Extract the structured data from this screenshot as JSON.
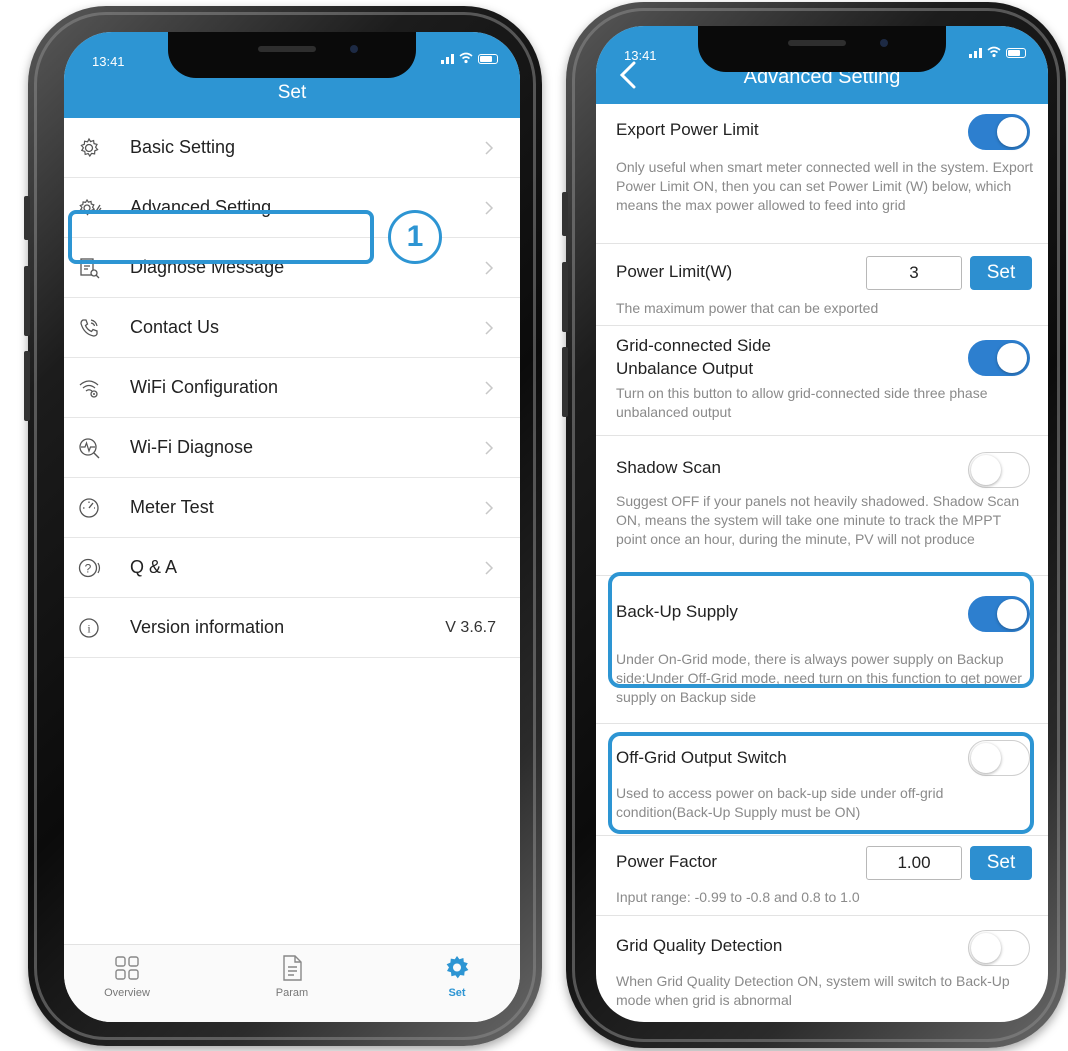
{
  "left_phone": {
    "status_time": "13:41",
    "title": "Set",
    "menu": [
      {
        "label": "Basic Setting",
        "icon": "gear-icon"
      },
      {
        "label": "Advanced Setting",
        "icon": "advanced-gear-icon"
      },
      {
        "label": "Diagnose Message",
        "icon": "document-search-icon"
      },
      {
        "label": "Contact Us",
        "icon": "phone-icon"
      },
      {
        "label": "WiFi Configuration",
        "icon": "wifi-gear-icon"
      },
      {
        "label": "Wi-Fi Diagnose",
        "icon": "pulse-icon"
      },
      {
        "label": "Meter Test",
        "icon": "gauge-icon"
      },
      {
        "label": "Q & A",
        "icon": "question-icon"
      },
      {
        "label": "Version information",
        "icon": "info-icon",
        "value": "V 3.6.7"
      }
    ],
    "step_badge": "1",
    "tabs": [
      {
        "label": "Overview",
        "icon": "grid-icon",
        "active": false
      },
      {
        "label": "Param",
        "icon": "document-icon",
        "active": false
      },
      {
        "label": "Set",
        "icon": "settings-icon",
        "active": true
      }
    ]
  },
  "right_phone": {
    "status_time": "13:41",
    "title": "Advanced Setting",
    "settings": {
      "export_power_limit": {
        "title": "Export Power Limit",
        "desc": "Only useful when smart meter connected well in the system. Export Power Limit ON, then you can set Power Limit (W) below, which means the max power allowed to feed into grid",
        "on": true
      },
      "power_limit": {
        "title": "Power Limit(W)",
        "value": "3",
        "button": "Set",
        "desc": "The maximum power that can be exported"
      },
      "unbalance_output": {
        "title_line1": "Grid-connected Side",
        "title_line2": "Unbalance Output",
        "desc": "Turn on this button to allow grid-connected side three phase unbalanced output",
        "on": true
      },
      "shadow_scan": {
        "title": "Shadow Scan",
        "desc": "Suggest OFF if your panels not heavily shadowed. Shadow Scan ON, means the system will take one minute to track the MPPT point once an hour, during the minute, PV will not produce",
        "on": false
      },
      "backup_supply": {
        "title": "Back-Up Supply",
        "desc": "Under On-Grid mode, there is always power supply on Backup side;Under Off-Grid mode, need turn on this function to get power supply on Backup side",
        "on": true
      },
      "off_grid_switch": {
        "title": "Off-Grid Output Switch",
        "desc": "Used to access power on back-up side under off-grid condition(Back-Up Supply must be ON)",
        "on": false
      },
      "power_factor": {
        "title": "Power Factor",
        "value": "1.00",
        "button": "Set",
        "desc": "Input range:  -0.99 to -0.8 and 0.8 to 1.0"
      },
      "grid_quality": {
        "title": "Grid Quality Detection",
        "desc": "When Grid Quality Detection ON, system will switch to Back-Up mode when grid is abnormal",
        "on": false
      }
    }
  },
  "colors": {
    "header_blue": "#2d95d3",
    "toggle_on": "#2d7fcf",
    "highlight": "#2d95d3"
  }
}
